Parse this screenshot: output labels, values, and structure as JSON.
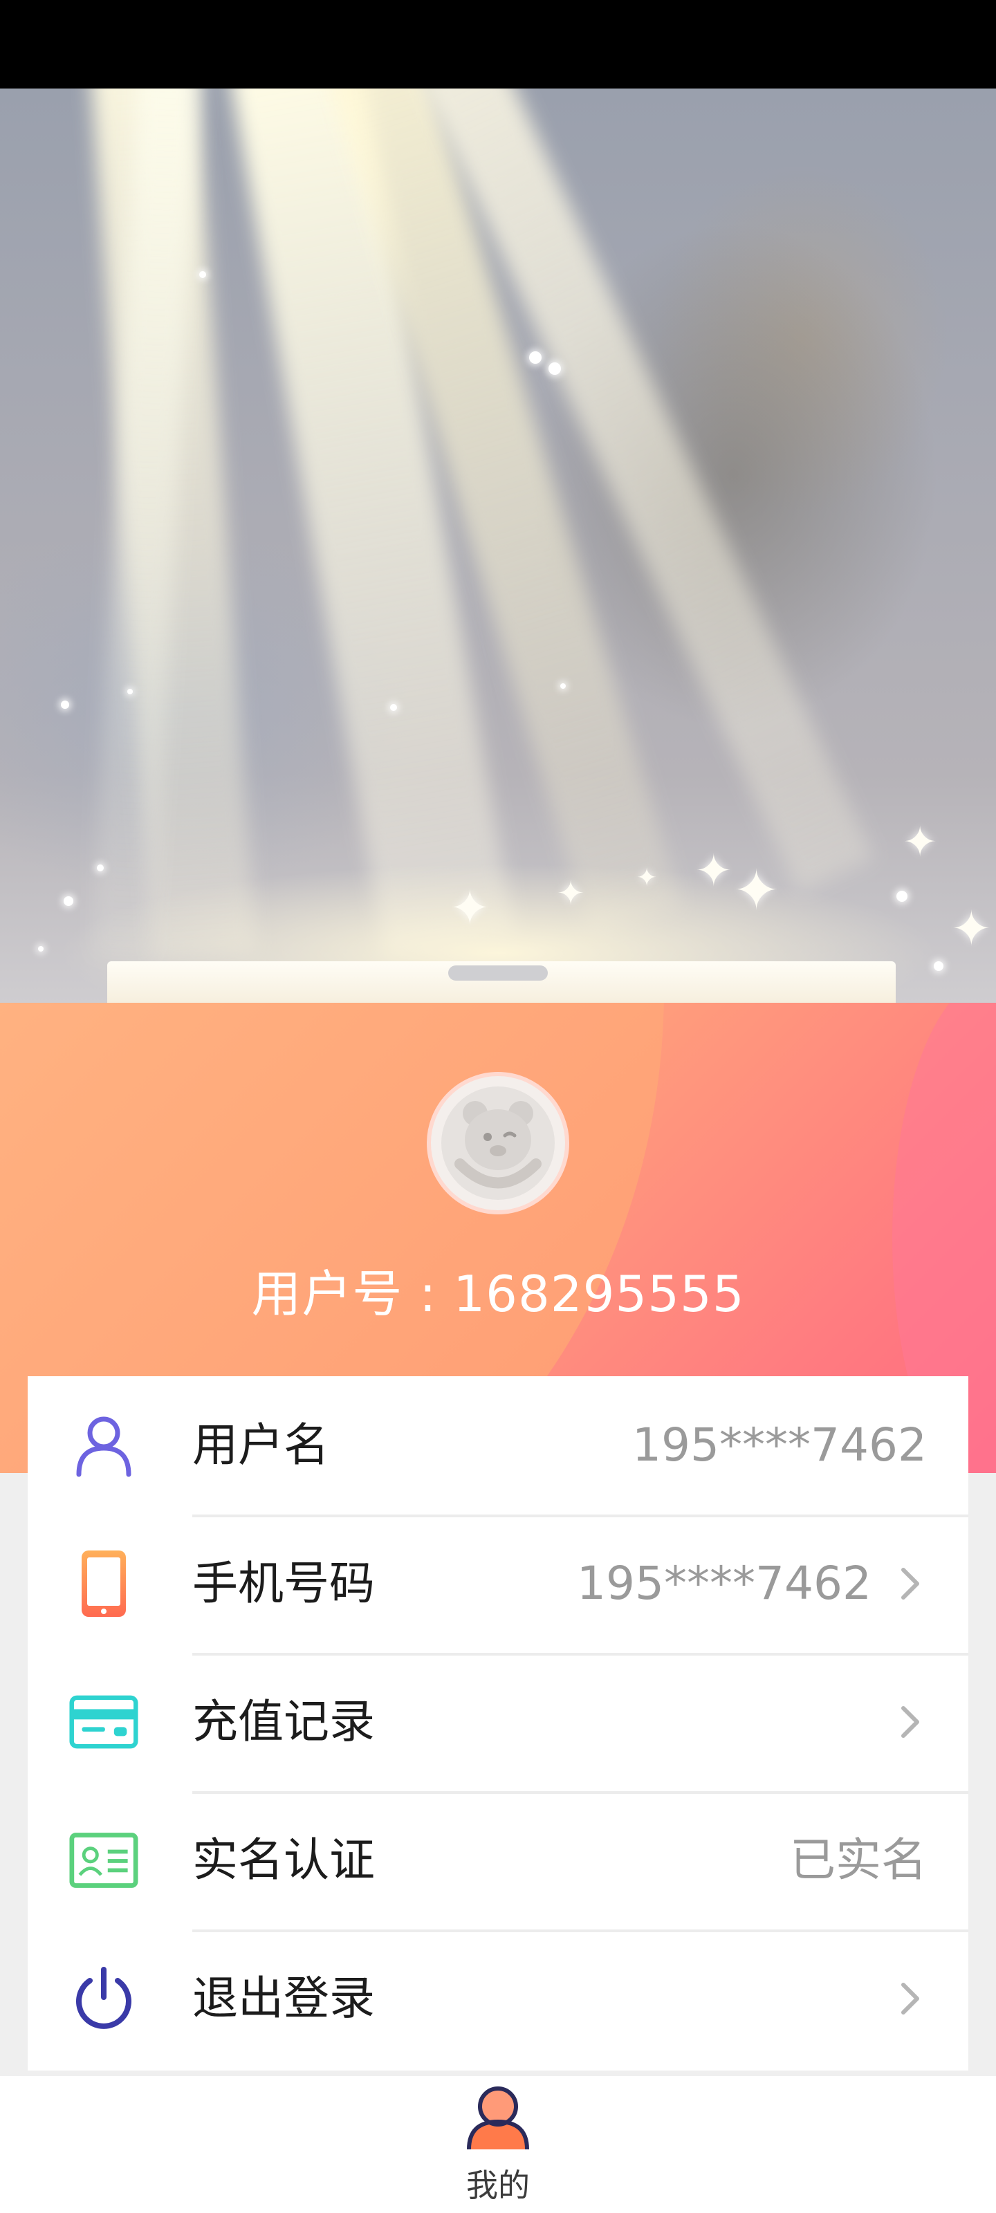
{
  "profile": {
    "user_id_label": "用户号 : 168295555"
  },
  "menu": {
    "items": [
      {
        "label": "用户名",
        "value": "195****7462",
        "icon": "user-icon",
        "has_chevron": false
      },
      {
        "label": "手机号码",
        "value": "195****7462",
        "icon": "phone-icon",
        "has_chevron": true
      },
      {
        "label": "充值记录",
        "value": "",
        "icon": "card-icon",
        "has_chevron": true
      },
      {
        "label": "实名认证",
        "value": "已实名",
        "icon": "id-card-icon",
        "has_chevron": false
      },
      {
        "label": "退出登录",
        "value": "",
        "icon": "power-icon",
        "has_chevron": true
      }
    ]
  },
  "tabbar": {
    "items": [
      {
        "label": "我的",
        "icon": "me-icon",
        "active": true
      }
    ]
  },
  "colors": {
    "profile_gradient_start": "#ffb98a",
    "profile_gradient_end": "#ff6a80",
    "user_icon": "#6d63e0",
    "phone_icon": "#ff8a50",
    "card_icon": "#2ed3d0",
    "id_icon": "#5bd17d",
    "power_icon": "#3a3aa8"
  }
}
